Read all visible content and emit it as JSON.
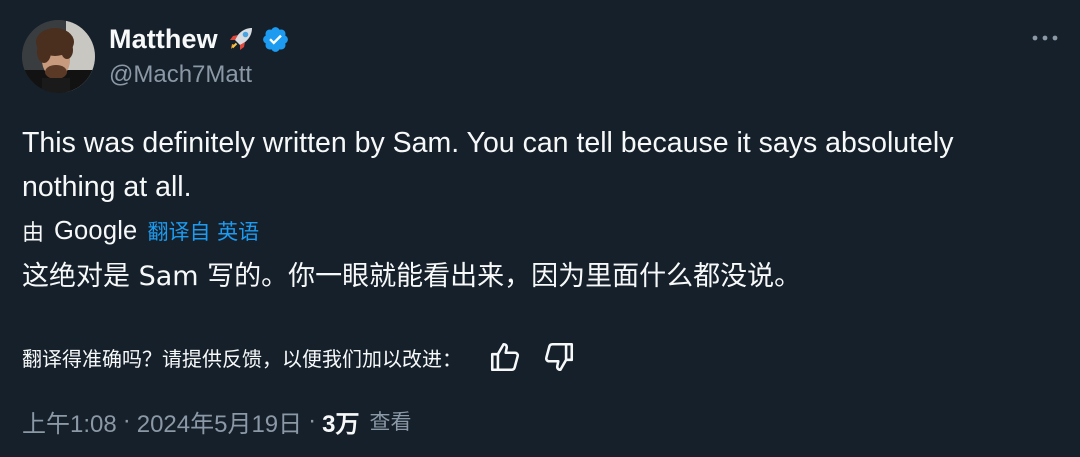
{
  "author": {
    "name": "Matthew",
    "handle": "@Mach7Matt",
    "emoji_icon": "rocket-icon",
    "verified_icon": "verified-badge-icon"
  },
  "tweet": {
    "text": "This was definitely written by Sam. You can tell because it says absolutely nothing at all."
  },
  "translation": {
    "by_label": "由",
    "provider": "Google",
    "action_label": "翻译自 英语",
    "translated_text": "这绝对是 Sam 写的。你一眼就能看出来，因为里面什么都没说。",
    "feedback_prompt": "翻译得准确吗？请提供反馈，以便我们加以改进：",
    "thumbs_up_icon": "thumbs-up-icon",
    "thumbs_down_icon": "thumbs-down-icon"
  },
  "meta": {
    "time": "上午1:08",
    "separator": "·",
    "date": "2024年5月19日",
    "views_count": "3万",
    "views_label": "查看"
  },
  "menu": {
    "more_icon": "more-dots-icon"
  },
  "colors": {
    "background": "#15202b",
    "text_primary": "#f7f9f9",
    "text_secondary": "#8b98a5",
    "accent": "#1d9bf0"
  }
}
